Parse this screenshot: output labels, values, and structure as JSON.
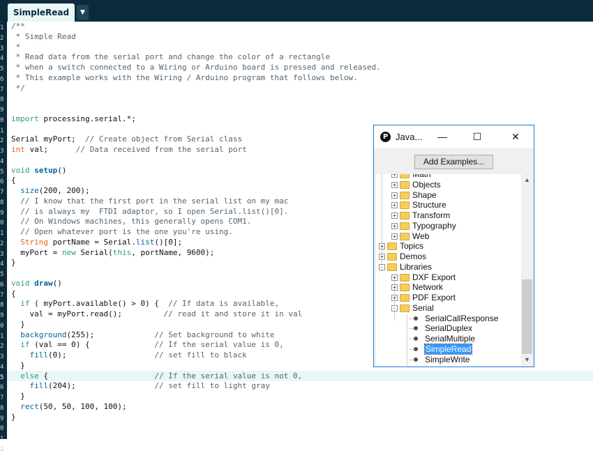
{
  "editor": {
    "tab_label": "SimpleRead",
    "tab_menu_icon": "chevron-down-icon",
    "line_numbers": [
      "1",
      "2",
      "3",
      "4",
      "5",
      "6",
      "7",
      "8",
      "9",
      "0",
      "1",
      "2",
      "3",
      "4",
      "5",
      "6",
      "7",
      "8",
      "9",
      "0",
      "1",
      "2",
      "3",
      "4",
      "5",
      "6",
      "7",
      "8",
      "9",
      "0",
      "1",
      "2",
      "3",
      "4",
      "5",
      "6",
      "7",
      "8",
      "9",
      "0",
      "1",
      "2"
    ],
    "highlighted_line_number": "5",
    "lines": [
      [
        {
          "t": "/**",
          "c": "comment"
        }
      ],
      [
        {
          "t": " * Simple Read",
          "c": "comment"
        }
      ],
      [
        {
          "t": " *",
          "c": "comment"
        }
      ],
      [
        {
          "t": " * Read data from the serial port and change the color of a rectangle",
          "c": "comment"
        }
      ],
      [
        {
          "t": " * when a switch connected to a Wiring or Arduino board is pressed and released.",
          "c": "comment"
        }
      ],
      [
        {
          "t": " * This example works with the Wiring / Arduino program that follows below.",
          "c": "comment"
        }
      ],
      [
        {
          "t": " */",
          "c": "comment"
        }
      ],
      [],
      [],
      [
        {
          "t": "import",
          "c": "keyword"
        },
        {
          "t": " processing.serial.*;",
          "c": "plain"
        }
      ],
      [],
      [
        {
          "t": "Serial myPort;  ",
          "c": "plain"
        },
        {
          "t": "// Create object from Serial class",
          "c": "comment"
        }
      ],
      [
        {
          "t": "int",
          "c": "type"
        },
        {
          "t": " val;      ",
          "c": "plain"
        },
        {
          "t": "// Data received from the serial port",
          "c": "comment"
        }
      ],
      [],
      [
        {
          "t": "void",
          "c": "keyword"
        },
        {
          "t": " ",
          "c": "plain"
        },
        {
          "t": "setup",
          "c": "func"
        },
        {
          "t": "()",
          "c": "plain"
        }
      ],
      [
        {
          "t": "{",
          "c": "plain"
        }
      ],
      [
        {
          "t": "  ",
          "c": "plain"
        },
        {
          "t": "size",
          "c": "builtin"
        },
        {
          "t": "(200, 200);",
          "c": "plain"
        }
      ],
      [
        {
          "t": "  // I know that the first port in the serial list on my mac",
          "c": "comment"
        }
      ],
      [
        {
          "t": "  // is always my  FTDI adaptor, so I open Serial.list()[0].",
          "c": "comment"
        }
      ],
      [
        {
          "t": "  // On Windows machines, this generally opens COM1.",
          "c": "comment"
        }
      ],
      [
        {
          "t": "  // Open whatever port is the one you're using.",
          "c": "comment"
        }
      ],
      [
        {
          "t": "  ",
          "c": "plain"
        },
        {
          "t": "String",
          "c": "type"
        },
        {
          "t": " portName = Serial.",
          "c": "plain"
        },
        {
          "t": "list",
          "c": "builtin"
        },
        {
          "t": "()[0];",
          "c": "plain"
        }
      ],
      [
        {
          "t": "  myPort = ",
          "c": "plain"
        },
        {
          "t": "new",
          "c": "keyword"
        },
        {
          "t": " Serial(",
          "c": "plain"
        },
        {
          "t": "this",
          "c": "keyword"
        },
        {
          "t": ", portName, 9600);",
          "c": "plain"
        }
      ],
      [
        {
          "t": "}",
          "c": "plain"
        }
      ],
      [],
      [
        {
          "t": "void",
          "c": "keyword"
        },
        {
          "t": " ",
          "c": "plain"
        },
        {
          "t": "draw",
          "c": "func"
        },
        {
          "t": "()",
          "c": "plain"
        }
      ],
      [
        {
          "t": "{",
          "c": "plain"
        }
      ],
      [
        {
          "t": "  ",
          "c": "plain"
        },
        {
          "t": "if",
          "c": "keyword"
        },
        {
          "t": " ( myPort.available() > 0) {  ",
          "c": "plain"
        },
        {
          "t": "// If data is available,",
          "c": "comment"
        }
      ],
      [
        {
          "t": "    val = myPort.read();         ",
          "c": "plain"
        },
        {
          "t": "// read it and store it in val",
          "c": "comment"
        }
      ],
      [
        {
          "t": "  }",
          "c": "plain"
        }
      ],
      [
        {
          "t": "  ",
          "c": "plain"
        },
        {
          "t": "background",
          "c": "builtin"
        },
        {
          "t": "(255);             ",
          "c": "plain"
        },
        {
          "t": "// Set background to white",
          "c": "comment"
        }
      ],
      [
        {
          "t": "  ",
          "c": "plain"
        },
        {
          "t": "if",
          "c": "keyword"
        },
        {
          "t": " (val == 0) {              ",
          "c": "plain"
        },
        {
          "t": "// If the serial value is 0,",
          "c": "comment"
        }
      ],
      [
        {
          "t": "    ",
          "c": "plain"
        },
        {
          "t": "fill",
          "c": "builtin"
        },
        {
          "t": "(0);                   ",
          "c": "plain"
        },
        {
          "t": "// set fill to black",
          "c": "comment"
        }
      ],
      [
        {
          "t": "  }",
          "c": "plain"
        }
      ],
      [
        {
          "t": "  ",
          "c": "plain"
        },
        {
          "t": "else",
          "c": "keyword"
        },
        {
          "t": " {                       ",
          "c": "plain"
        },
        {
          "t": "// If the serial value is not 0,",
          "c": "comment"
        }
      ],
      [
        {
          "t": "    ",
          "c": "plain"
        },
        {
          "t": "fill",
          "c": "builtin"
        },
        {
          "t": "(204);                 ",
          "c": "plain"
        },
        {
          "t": "// set fill to light gray",
          "c": "comment"
        }
      ],
      [
        {
          "t": "  }",
          "c": "plain"
        }
      ],
      [
        {
          "t": "  ",
          "c": "plain"
        },
        {
          "t": "rect",
          "c": "builtin"
        },
        {
          "t": "(50, 50, 100, 100);",
          "c": "plain"
        }
      ],
      [
        {
          "t": "}",
          "c": "plain"
        }
      ]
    ]
  },
  "examples_window": {
    "title": "Java...",
    "app_icon": "processing-logo-icon",
    "controls": {
      "minimize": "minimize-icon",
      "maximize": "maximize-icon",
      "close": "close-icon"
    },
    "add_examples_label": "Add Examples...",
    "tree": [
      {
        "label": "Math",
        "kind": "folder",
        "expand": "+",
        "partial": true
      },
      {
        "label": "Objects",
        "kind": "folder",
        "expand": "+"
      },
      {
        "label": "Shape",
        "kind": "folder",
        "expand": "+"
      },
      {
        "label": "Structure",
        "kind": "folder",
        "expand": "+"
      },
      {
        "label": "Transform",
        "kind": "folder",
        "expand": "+"
      },
      {
        "label": "Typography",
        "kind": "folder",
        "expand": "+"
      },
      {
        "label": "Web",
        "kind": "folder",
        "expand": "+"
      },
      {
        "label": "Topics",
        "kind": "folder",
        "expand": "+"
      },
      {
        "label": "Demos",
        "kind": "folder",
        "expand": "+"
      },
      {
        "label": "Libraries",
        "kind": "folder",
        "expand": "-"
      },
      {
        "label": "DXF Export",
        "kind": "folder",
        "expand": "+"
      },
      {
        "label": "Network",
        "kind": "folder",
        "expand": "+"
      },
      {
        "label": "PDF Export",
        "kind": "folder",
        "expand": "+"
      },
      {
        "label": "Serial",
        "kind": "folder",
        "expand": "-"
      },
      {
        "label": "SerialCallResponse",
        "kind": "leaf"
      },
      {
        "label": "SerialDuplex",
        "kind": "leaf"
      },
      {
        "label": "SerialMultiple",
        "kind": "leaf"
      },
      {
        "label": "SimpleRead",
        "kind": "leaf",
        "selected": true
      },
      {
        "label": "SimpleWrite",
        "kind": "leaf"
      }
    ],
    "scroll_up_icon": "chevron-up-icon",
    "scroll_down_icon": "chevron-down-icon"
  },
  "colors": {
    "header_bg": "#0b2a3b",
    "tab_bg": "#e9f6f6",
    "keyword": "#33997e",
    "function": "#006699",
    "type": "#e2661a",
    "comment": "#56646e",
    "selection": "#3399ff",
    "window_border": "#1e7dd0"
  }
}
